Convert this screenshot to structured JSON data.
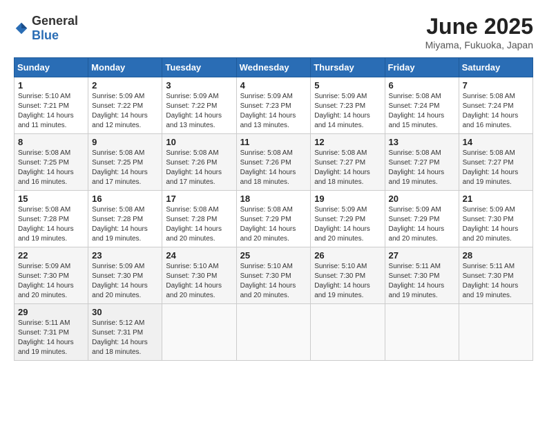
{
  "header": {
    "logo": {
      "general": "General",
      "blue": "Blue"
    },
    "title": "June 2025",
    "location": "Miyama, Fukuoka, Japan"
  },
  "calendar": {
    "days_of_week": [
      "Sunday",
      "Monday",
      "Tuesday",
      "Wednesday",
      "Thursday",
      "Friday",
      "Saturday"
    ],
    "weeks": [
      [
        null,
        null,
        null,
        null,
        null,
        null,
        null
      ]
    ],
    "cells": [
      {
        "day": "1",
        "sunrise": "5:10 AM",
        "sunset": "7:21 PM",
        "daylight": "14 hours and 11 minutes."
      },
      {
        "day": "2",
        "sunrise": "5:09 AM",
        "sunset": "7:22 PM",
        "daylight": "14 hours and 12 minutes."
      },
      {
        "day": "3",
        "sunrise": "5:09 AM",
        "sunset": "7:22 PM",
        "daylight": "14 hours and 13 minutes."
      },
      {
        "day": "4",
        "sunrise": "5:09 AM",
        "sunset": "7:23 PM",
        "daylight": "14 hours and 13 minutes."
      },
      {
        "day": "5",
        "sunrise": "5:09 AM",
        "sunset": "7:23 PM",
        "daylight": "14 hours and 14 minutes."
      },
      {
        "day": "6",
        "sunrise": "5:08 AM",
        "sunset": "7:24 PM",
        "daylight": "14 hours and 15 minutes."
      },
      {
        "day": "7",
        "sunrise": "5:08 AM",
        "sunset": "7:24 PM",
        "daylight": "14 hours and 16 minutes."
      },
      {
        "day": "8",
        "sunrise": "5:08 AM",
        "sunset": "7:25 PM",
        "daylight": "14 hours and 16 minutes."
      },
      {
        "day": "9",
        "sunrise": "5:08 AM",
        "sunset": "7:25 PM",
        "daylight": "14 hours and 17 minutes."
      },
      {
        "day": "10",
        "sunrise": "5:08 AM",
        "sunset": "7:26 PM",
        "daylight": "14 hours and 17 minutes."
      },
      {
        "day": "11",
        "sunrise": "5:08 AM",
        "sunset": "7:26 PM",
        "daylight": "14 hours and 18 minutes."
      },
      {
        "day": "12",
        "sunrise": "5:08 AM",
        "sunset": "7:27 PM",
        "daylight": "14 hours and 18 minutes."
      },
      {
        "day": "13",
        "sunrise": "5:08 AM",
        "sunset": "7:27 PM",
        "daylight": "14 hours and 19 minutes."
      },
      {
        "day": "14",
        "sunrise": "5:08 AM",
        "sunset": "7:27 PM",
        "daylight": "14 hours and 19 minutes."
      },
      {
        "day": "15",
        "sunrise": "5:08 AM",
        "sunset": "7:28 PM",
        "daylight": "14 hours and 19 minutes."
      },
      {
        "day": "16",
        "sunrise": "5:08 AM",
        "sunset": "7:28 PM",
        "daylight": "14 hours and 19 minutes."
      },
      {
        "day": "17",
        "sunrise": "5:08 AM",
        "sunset": "7:28 PM",
        "daylight": "14 hours and 20 minutes."
      },
      {
        "day": "18",
        "sunrise": "5:08 AM",
        "sunset": "7:29 PM",
        "daylight": "14 hours and 20 minutes."
      },
      {
        "day": "19",
        "sunrise": "5:09 AM",
        "sunset": "7:29 PM",
        "daylight": "14 hours and 20 minutes."
      },
      {
        "day": "20",
        "sunrise": "5:09 AM",
        "sunset": "7:29 PM",
        "daylight": "14 hours and 20 minutes."
      },
      {
        "day": "21",
        "sunrise": "5:09 AM",
        "sunset": "7:30 PM",
        "daylight": "14 hours and 20 minutes."
      },
      {
        "day": "22",
        "sunrise": "5:09 AM",
        "sunset": "7:30 PM",
        "daylight": "14 hours and 20 minutes."
      },
      {
        "day": "23",
        "sunrise": "5:09 AM",
        "sunset": "7:30 PM",
        "daylight": "14 hours and 20 minutes."
      },
      {
        "day": "24",
        "sunrise": "5:10 AM",
        "sunset": "7:30 PM",
        "daylight": "14 hours and 20 minutes."
      },
      {
        "day": "25",
        "sunrise": "5:10 AM",
        "sunset": "7:30 PM",
        "daylight": "14 hours and 20 minutes."
      },
      {
        "day": "26",
        "sunrise": "5:10 AM",
        "sunset": "7:30 PM",
        "daylight": "14 hours and 19 minutes."
      },
      {
        "day": "27",
        "sunrise": "5:11 AM",
        "sunset": "7:30 PM",
        "daylight": "14 hours and 19 minutes."
      },
      {
        "day": "28",
        "sunrise": "5:11 AM",
        "sunset": "7:30 PM",
        "daylight": "14 hours and 19 minutes."
      },
      {
        "day": "29",
        "sunrise": "5:11 AM",
        "sunset": "7:31 PM",
        "daylight": "14 hours and 19 minutes."
      },
      {
        "day": "30",
        "sunrise": "5:12 AM",
        "sunset": "7:31 PM",
        "daylight": "14 hours and 18 minutes."
      }
    ]
  }
}
